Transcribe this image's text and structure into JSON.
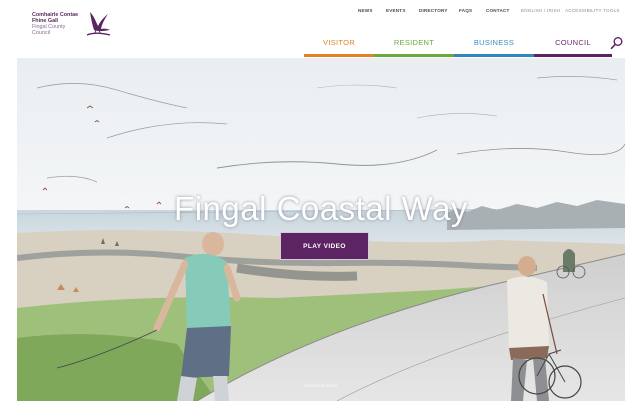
{
  "logo": {
    "line1": "Comhairle Contae",
    "line2": "Fhine Gall",
    "line3": "Fingal County",
    "line4": "Council",
    "icon": "heron-bird-logo"
  },
  "top_links": [
    "NEWS",
    "EVENTS",
    "DIRECTORY",
    "FAQS",
    "CONTACT",
    "ENGLISH / IRISH",
    "ACCESSIBILITY TOOLS"
  ],
  "nav": {
    "visitor": "VISITOR",
    "resident": "RESIDENT",
    "business": "BUSINESS",
    "council": "COUNCIL"
  },
  "search_icon": "search-icon",
  "colors": {
    "visitor": "#e0822a",
    "resident": "#6aa83d",
    "business": "#2f86c1",
    "council": "#5d2260",
    "play_button": "#5d2463"
  },
  "hero": {
    "title": "Fingal Coastal Way",
    "button": "PLAY VIDEO",
    "scroll_hint": "DISCOVER MORE"
  }
}
